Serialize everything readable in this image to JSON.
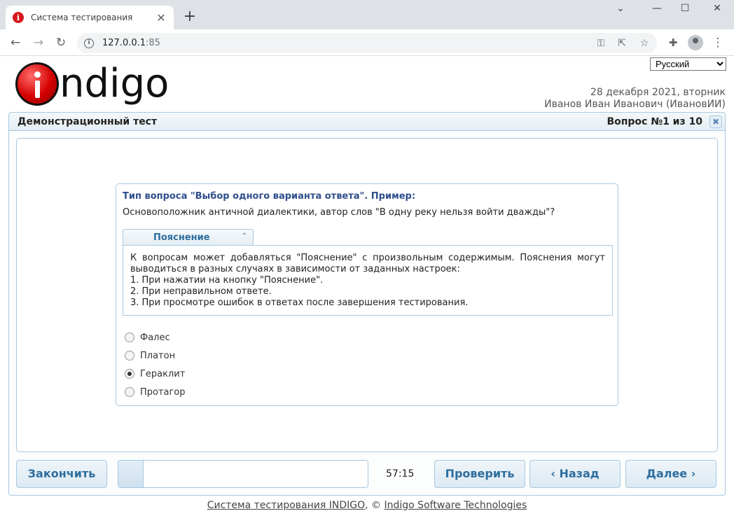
{
  "browser": {
    "tab_title": "Система тестирования",
    "tab_close": "✕",
    "new_tab": "+",
    "url_host": "127.0.0.1",
    "url_port": ":85",
    "info": "i"
  },
  "header": {
    "logo_text": "ndigo",
    "language": "Русский",
    "languages": [
      "Русский"
    ],
    "date": "28 декабря 2021, вторник",
    "user": "Иванов Иван Иванович (ИвановИИ)"
  },
  "panel": {
    "test_title": "Демонстрационный тест",
    "question_counter": "Вопрос №1 из 10",
    "close_glyph": "✖"
  },
  "question": {
    "type_label": "Тип вопроса \"Выбор одного варианта ответа\". Пример:",
    "text": "Основоположник античной диалектики, автор слов \"В одну реку нельзя войти дважды\"?",
    "explanation_tab": "Пояснение",
    "explanation_intro": "К вопросам может добавляться \"Пояснение\" с произвольным содержимым. Пояснения могут выводиться в разных случаях в зависимости от заданных настроек:",
    "explanation_items": [
      "1. При нажатии на кнопку \"Пояснение\".",
      "2. При неправильном ответе.",
      "3. При просмотре ошибок в ответах после завершения тестирования."
    ],
    "options": [
      {
        "label": "Фалес",
        "selected": false
      },
      {
        "label": "Платон",
        "selected": false
      },
      {
        "label": "Гераклит",
        "selected": true
      },
      {
        "label": "Протагор",
        "selected": false
      }
    ]
  },
  "controls": {
    "finish": "Закончить",
    "progress_fraction": 0.1,
    "timer": "57:15",
    "check": "Проверить",
    "back": "‹ Назад",
    "next": "Далее ›"
  },
  "footer": {
    "system_link": "Система тестирования INDIGO",
    "separator": ", © ",
    "company_link": "Indigo Software Technologies"
  }
}
